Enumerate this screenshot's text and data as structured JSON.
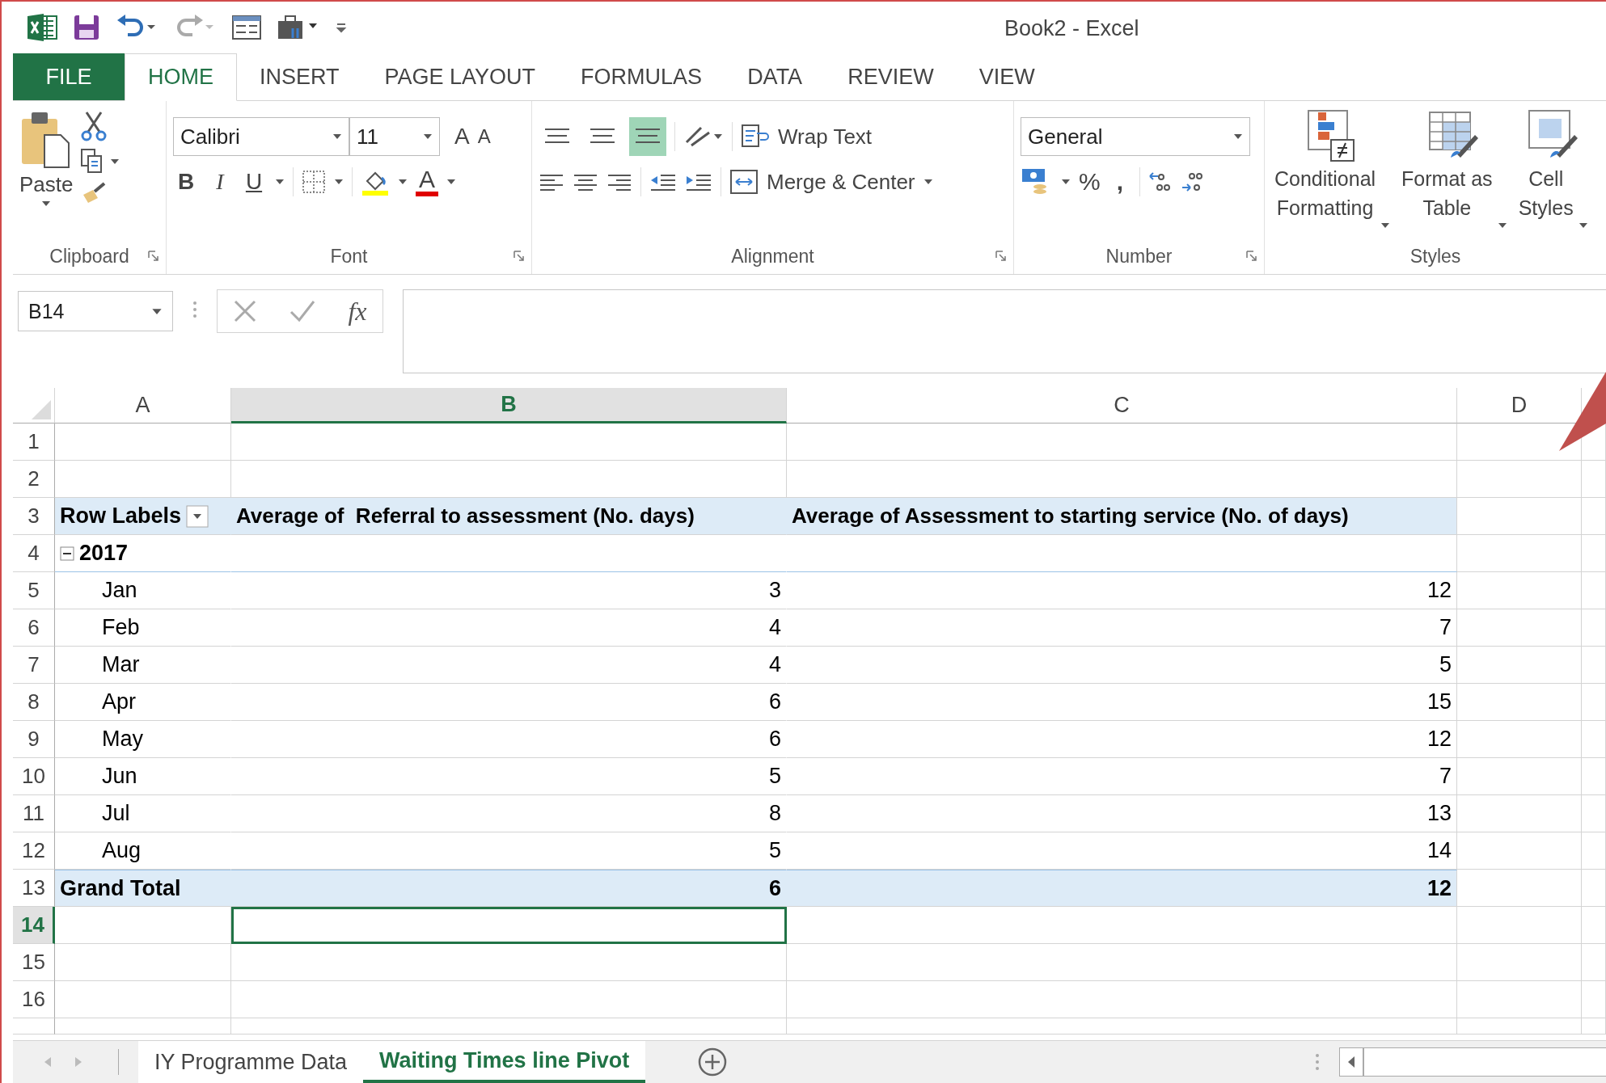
{
  "window": {
    "title": "Book2 - Excel"
  },
  "ribbon_tabs": [
    {
      "label": "FILE",
      "kind": "file",
      "selected": false
    },
    {
      "label": "HOME",
      "kind": "tab",
      "selected": true
    },
    {
      "label": "INSERT",
      "kind": "tab",
      "selected": false
    },
    {
      "label": "PAGE LAYOUT",
      "kind": "tab",
      "selected": false
    },
    {
      "label": "FORMULAS",
      "kind": "tab",
      "selected": false
    },
    {
      "label": "DATA",
      "kind": "tab",
      "selected": false
    },
    {
      "label": "REVIEW",
      "kind": "tab",
      "selected": false
    },
    {
      "label": "VIEW",
      "kind": "tab",
      "selected": false
    }
  ],
  "clipboard": {
    "paste": "Paste",
    "group": "Clipboard"
  },
  "font": {
    "name": "Calibri",
    "size": "11",
    "grow": "A",
    "shrink": "A",
    "bold": "B",
    "italic": "I",
    "underline": "U",
    "font_color": "A",
    "group": "Font"
  },
  "alignment": {
    "vertical_align": [
      {
        "selected": false
      },
      {
        "selected": false
      },
      {
        "selected": true
      }
    ],
    "wrap_text": "Wrap Text",
    "merge": "Merge & Center",
    "group": "Alignment"
  },
  "number": {
    "format": "General",
    "percent": "%",
    "comma": ",",
    "group": "Number"
  },
  "styles": {
    "buttons": [
      {
        "line1": "Conditional",
        "line2": "Formatting",
        "kind": "conditional"
      },
      {
        "line1": "Format as",
        "line2": "Table",
        "kind": "table"
      },
      {
        "line1": "Cell",
        "line2": "Styles",
        "kind": "cell"
      }
    ],
    "group": "Styles"
  },
  "name_box": "B14",
  "formula_bar": {
    "fx": "fx"
  },
  "sheet": {
    "columns": [
      {
        "label": "A",
        "selected": false
      },
      {
        "label": "B",
        "selected": true
      },
      {
        "label": "C",
        "selected": false
      },
      {
        "label": "D",
        "selected": false
      }
    ],
    "rows": [
      {
        "number": "1",
        "kind": "empty",
        "selected": false
      },
      {
        "number": "2",
        "kind": "empty",
        "selected": false
      },
      {
        "number": "3",
        "kind": "header",
        "selected": false,
        "label": "Row Labels",
        "values": [
          "Average of  Referral to assessment (No. days)",
          "Average of Assessment to starting service (No. of days)"
        ]
      },
      {
        "number": "4",
        "kind": "group",
        "selected": false,
        "label": "2017",
        "expanded": true
      },
      {
        "number": "5",
        "kind": "item",
        "selected": false,
        "label": "Jan",
        "values": [
          "3",
          "12"
        ]
      },
      {
        "number": "6",
        "kind": "item",
        "selected": false,
        "label": "Feb",
        "values": [
          "4",
          "7"
        ]
      },
      {
        "number": "7",
        "kind": "item",
        "selected": false,
        "label": "Mar",
        "values": [
          "4",
          "5"
        ]
      },
      {
        "number": "8",
        "kind": "item",
        "selected": false,
        "label": "Apr",
        "values": [
          "6",
          "15"
        ]
      },
      {
        "number": "9",
        "kind": "item",
        "selected": false,
        "label": "May",
        "values": [
          "6",
          "12"
        ]
      },
      {
        "number": "10",
        "kind": "item",
        "selected": false,
        "label": "Jun",
        "values": [
          "5",
          "7"
        ]
      },
      {
        "number": "11",
        "kind": "item",
        "selected": false,
        "label": "Jul",
        "values": [
          "8",
          "13"
        ]
      },
      {
        "number": "12",
        "kind": "item",
        "selected": false,
        "label": "Aug",
        "values": [
          "5",
          "14"
        ]
      },
      {
        "number": "13",
        "kind": "total",
        "selected": false,
        "label": "Grand Total",
        "values": [
          "6",
          "12"
        ]
      },
      {
        "number": "14",
        "kind": "empty",
        "selected": true
      },
      {
        "number": "15",
        "kind": "empty",
        "selected": false
      },
      {
        "number": "16",
        "kind": "empty",
        "selected": false
      }
    ]
  },
  "sheet_tabs": [
    {
      "label": "IY Programme Data",
      "selected": false
    },
    {
      "label": "Waiting Times line Pivot",
      "selected": true
    }
  ]
}
